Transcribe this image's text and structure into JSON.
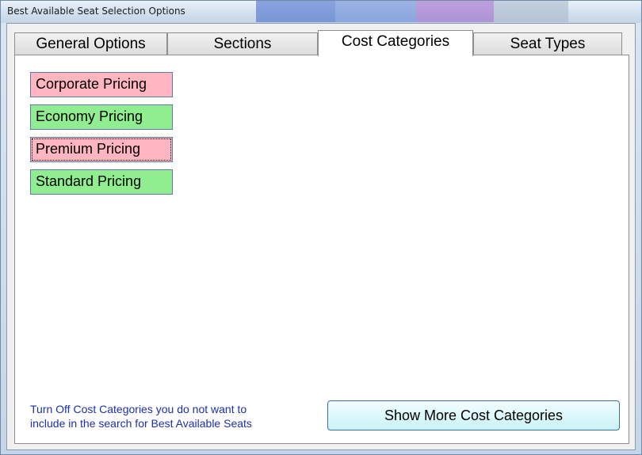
{
  "window": {
    "title": "Best Available Seat Selection Options"
  },
  "tabs": [
    {
      "label": "General Options",
      "active": false
    },
    {
      "label": "Sections",
      "active": false
    },
    {
      "label": "Cost Categories",
      "active": true
    },
    {
      "label": "Seat Types",
      "active": false
    }
  ],
  "cost_categories": [
    {
      "label": "Corporate Pricing",
      "enabled": false,
      "color": "#ffb6c1"
    },
    {
      "label": "Economy Pricing",
      "enabled": true,
      "color": "#90ee90"
    },
    {
      "label": "Premium Pricing",
      "enabled": false,
      "color": "#ffb6c1",
      "focused": true
    },
    {
      "label": "Standard Pricing",
      "enabled": true,
      "color": "#90ee90"
    }
  ],
  "hint": {
    "line1": "Turn Off Cost Categories you do not want to",
    "line2": "include in the search for Best Available Seats"
  },
  "buttons": {
    "show_more": "Show More Cost Categories"
  }
}
